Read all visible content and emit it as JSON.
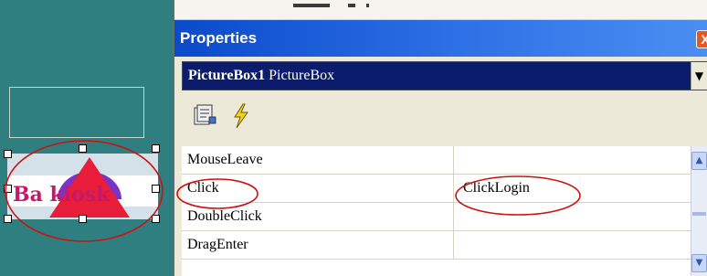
{
  "designer": {
    "picturebox": {
      "logo_text": "Ba kiosk"
    }
  },
  "properties": {
    "title": "Properties",
    "close_glyph": "X",
    "selector": {
      "object_name": "PictureBox1",
      "object_type": "PictureBox",
      "dropdown_glyph": "▼"
    },
    "toolbar": {
      "buttons": [
        {
          "name": "property-pages-icon"
        },
        {
          "name": "events-lightning-icon"
        }
      ]
    },
    "events": [
      {
        "name": "MouseLeave",
        "value": ""
      },
      {
        "name": "Click",
        "value": "ClickLogin"
      },
      {
        "name": "DoubleClick",
        "value": ""
      },
      {
        "name": "DragEnter",
        "value": ""
      }
    ],
    "scrollbar": {
      "up_glyph": "▲",
      "down_glyph": "▼"
    }
  },
  "colors": {
    "designer_bg": "#2f7f80",
    "titlebar": "#0a4acb",
    "selector_bg": "#0a1c6b",
    "annotation": "#cc1111",
    "logo_text": "#c4196b",
    "logo_triangle": "#e81d3a",
    "logo_arc": "#7a33c8"
  }
}
